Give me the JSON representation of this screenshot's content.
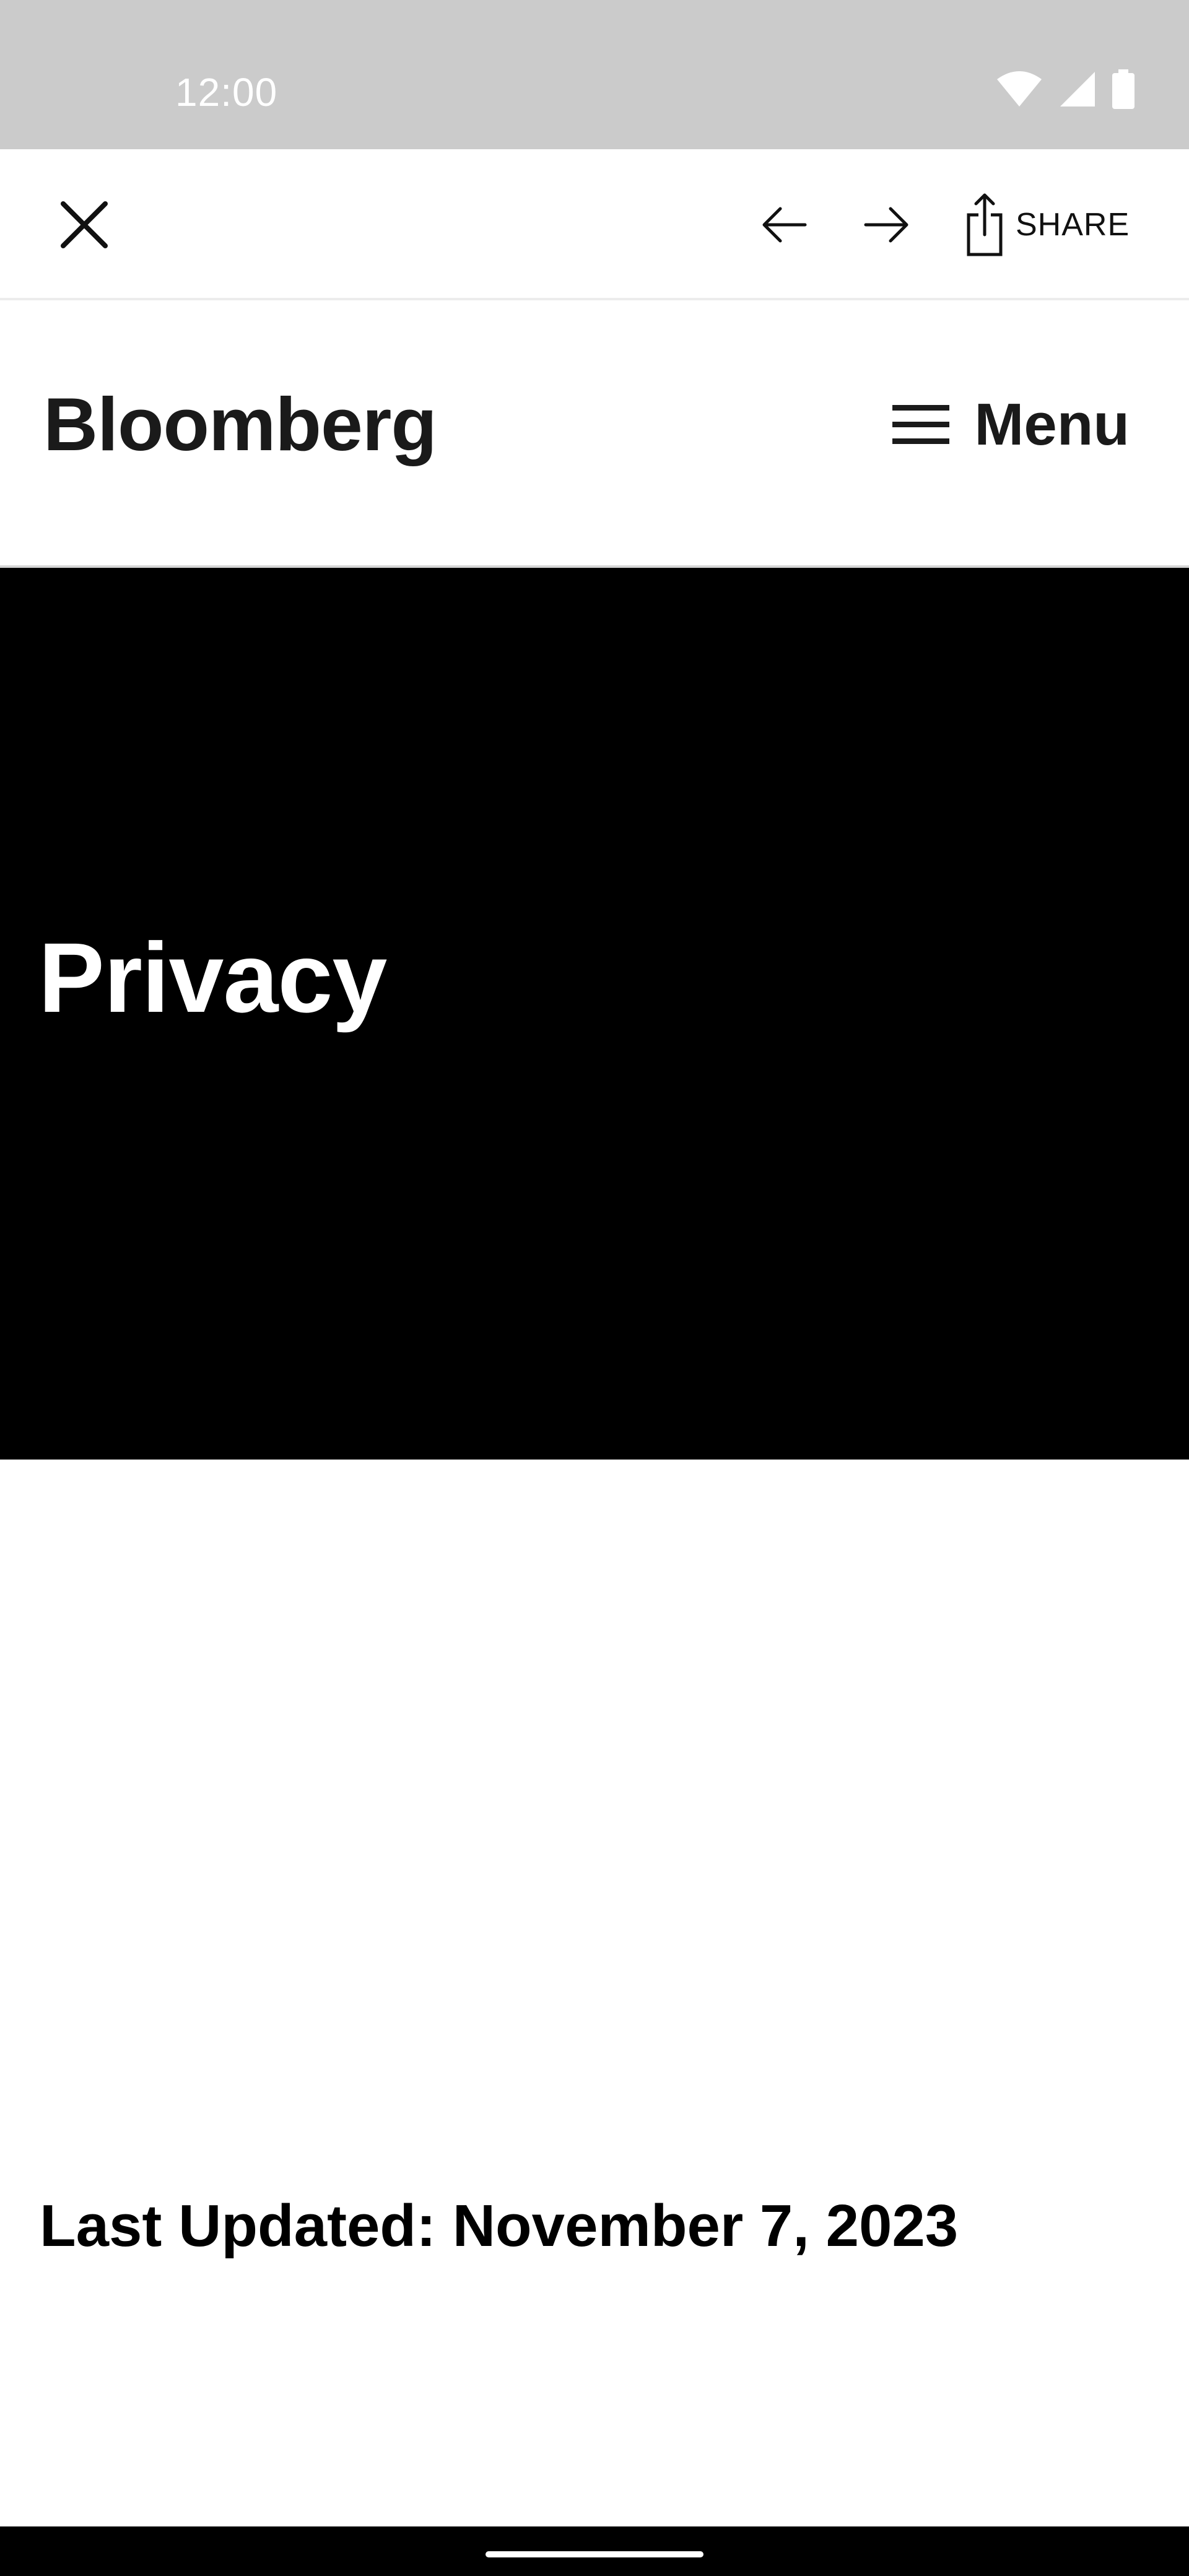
{
  "status_bar": {
    "time": "12:00"
  },
  "browser_bar": {
    "close_icon": "close-icon",
    "back_icon": "arrow-left-icon",
    "forward_icon": "arrow-right-icon",
    "share_label": "SHARE"
  },
  "site_header": {
    "logo": "Bloomberg",
    "menu_label": "Menu"
  },
  "hero": {
    "title": "Privacy"
  },
  "content": {
    "last_updated": "Last Updated: November 7, 2023"
  },
  "colors": {
    "status_bar": "#cbcbcb",
    "hero_bg": "#000000",
    "text": "#1a1a1a"
  }
}
